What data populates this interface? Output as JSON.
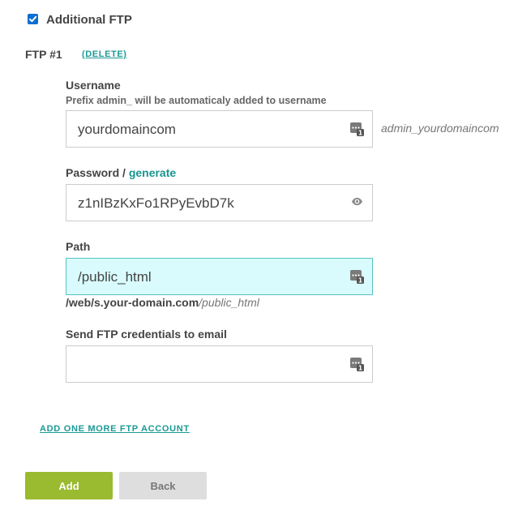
{
  "additional_ftp": {
    "label": "Additional FTP",
    "checked": true
  },
  "ftp_account": {
    "title": "FTP #1",
    "delete_label": "(DELETE)"
  },
  "username": {
    "label": "Username",
    "hint": "Prefix admin_ will be automaticaly added to username",
    "value": "yourdomaincom",
    "suffix": "admin_yourdomaincom",
    "icon": "password-manager-icon"
  },
  "password": {
    "label": "Password /",
    "generate_label": "generate",
    "value": "z1nIBzKxFo1RPyEvbD7k",
    "icon": "eye-icon"
  },
  "path": {
    "label": "Path",
    "value": "/public_html",
    "hint_base": "/web/s.your-domain.com",
    "hint_path": "/public_html",
    "icon": "password-manager-icon"
  },
  "send_email": {
    "label": "Send FTP credentials to email",
    "value": "",
    "icon": "password-manager-icon"
  },
  "add_more_label": "ADD ONE MORE FTP ACCOUNT",
  "buttons": {
    "add": "Add",
    "back": "Back"
  },
  "colors": {
    "accent": "#1a9a94",
    "add_button": "#9aba2f",
    "back_button": "#dedede",
    "focused_input": "#d9fbfd"
  }
}
